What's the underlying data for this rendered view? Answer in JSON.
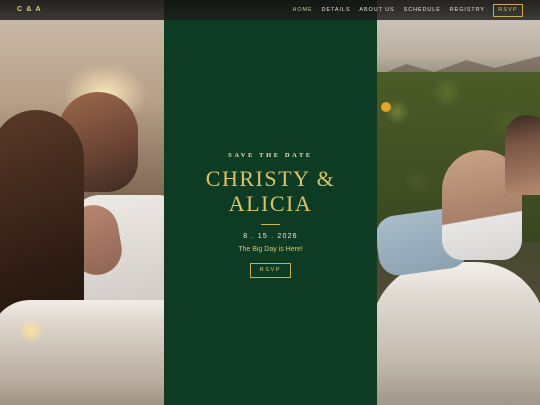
{
  "nav": {
    "logo": "C & A",
    "items": [
      {
        "label": "HOME",
        "active": true
      },
      {
        "label": "DETAILS",
        "active": false
      },
      {
        "label": "ABOUT US",
        "active": false
      },
      {
        "label": "SCHEDULE",
        "active": false
      },
      {
        "label": "REGISTRY",
        "active": false
      }
    ],
    "rsvp_label": "RSVP"
  },
  "hero": {
    "eyebrow": "SAVE THE DATE",
    "name_line1": "CHRISTY &",
    "name_line2": "ALICIA",
    "date": "8 . 15 . 2026",
    "tagline": "The Big Day is Here!",
    "rsvp_label": "RSVP"
  },
  "colors": {
    "panel_green": "#0d3b24",
    "gold": "#d9c46a",
    "nav_bg": "#1a1a18"
  }
}
